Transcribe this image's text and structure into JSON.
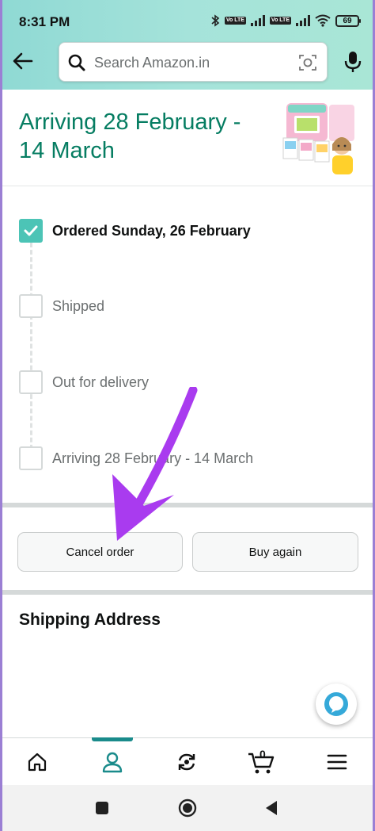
{
  "status_bar": {
    "time": "8:31 PM",
    "battery": "69",
    "volte1": "Vo LTE",
    "volte2": "Vo LTE"
  },
  "header": {
    "search": {
      "placeholder": "Search Amazon.in"
    },
    "icons": {
      "back": "arrow-left-icon",
      "search": "search-icon",
      "camera": "camera-scan-icon",
      "mic": "microphone-icon"
    }
  },
  "order": {
    "arriving_title": "Arriving 28 February - 14 March",
    "tracking_steps": [
      {
        "label": "Ordered Sunday, 26 February",
        "checked": true
      },
      {
        "label": "Shipped",
        "checked": false
      },
      {
        "label": "Out for delivery",
        "checked": false
      },
      {
        "label": "Arriving 28 February - 14 March",
        "checked": false
      }
    ],
    "actions": {
      "cancel_label": "Cancel order",
      "buy_again_label": "Buy again"
    }
  },
  "shipping": {
    "heading": "Shipping Address"
  },
  "bottom_nav": {
    "cart_count": "0",
    "items": [
      "home-icon",
      "profile-icon",
      "refresh-icon",
      "cart-icon",
      "menu-icon"
    ],
    "active": "profile-icon"
  },
  "colors": {
    "header_gradient_start": "#8fd9d4",
    "header_gradient_end": "#a9e6d6",
    "title_teal": "#067d62",
    "check_teal": "#4cc4b6",
    "annotation_arrow": "#a93bef"
  }
}
